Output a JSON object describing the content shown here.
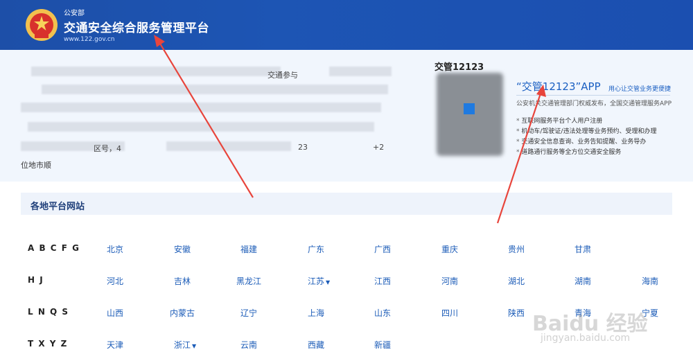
{
  "header": {
    "org": "公安部",
    "title": "交通安全综合服务管理平台",
    "url": "www.122.gov.cn"
  },
  "left_info": {
    "fragments": [
      "交通参与",
      "区号，4",
      "23",
      "+2"
    ],
    "footnote": "位地市顺"
  },
  "app": {
    "heading": "交管12123",
    "name": "“交管12123”APP",
    "slogan": "用心让交管业务更便捷",
    "description": "公安机关交通管理部门权威发布，全国交通管理服务APP",
    "features": [
      "互联网服务平台个人用户注册",
      "机动车/驾驶证/违法处理等业务预约、受理和办理",
      "交通安全信息查询、业务告知提醒、业务导办",
      "道路通行服务等全方位交通安全服务"
    ]
  },
  "local_platforms": {
    "title": "各地平台网站",
    "rows": [
      {
        "label": "A B C F G",
        "provinces": [
          "北京",
          "安徽",
          "福建",
          "广东",
          "广西",
          "重庆",
          "贵州",
          "甘肃"
        ]
      },
      {
        "label": "H J",
        "provinces": [
          "河北",
          "吉林",
          "黑龙江",
          "江苏",
          "江西",
          "河南",
          "湖北",
          "湖南",
          "海南"
        ]
      },
      {
        "label": "L N Q S",
        "provinces": [
          "山西",
          "内蒙古",
          "辽宁",
          "上海",
          "山东",
          "四川",
          "陕西",
          "青海",
          "宁夏"
        ]
      },
      {
        "label": "T X Y Z",
        "provinces": [
          "天津",
          "浙江",
          "云南",
          "西藏",
          "新疆"
        ]
      }
    ],
    "dropdown_caret": "▼"
  },
  "watermark": {
    "brand": "Baidu 经验",
    "url": "jingyan.baidu.com"
  },
  "colors": {
    "header_bg": "#1d55b4",
    "link": "#1c5cb8",
    "arrow": "#e8453c"
  }
}
